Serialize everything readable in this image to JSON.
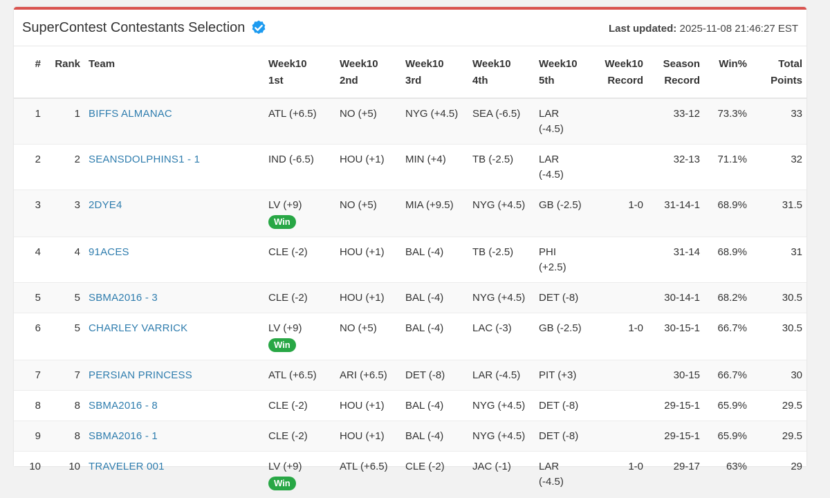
{
  "header": {
    "title": "SuperContest Contestants Selection",
    "last_updated_label": "Last updated:",
    "last_updated_value": "2025-11-08 21:46:27 EST"
  },
  "columns": {
    "num": "#",
    "rank": "Rank",
    "team": "Team",
    "w1": [
      "Week10",
      "1st"
    ],
    "w2": [
      "Week10",
      "2nd"
    ],
    "w3": [
      "Week10",
      "3rd"
    ],
    "w4": [
      "Week10",
      "4th"
    ],
    "w5": [
      "Week10",
      "5th"
    ],
    "record": [
      "Week10",
      "Record"
    ],
    "season": [
      "Season",
      "Record"
    ],
    "winpct": "Win%",
    "points": [
      "Total",
      "Points"
    ]
  },
  "win_label": "Win",
  "colors": {
    "accent": "#d9534f",
    "link": "#2f7dae",
    "win": "#28a745",
    "verified": "#1d9bf0"
  },
  "rows": [
    {
      "num": "1",
      "rank": "1",
      "team": "BIFFS ALMANAC",
      "picks": [
        "ATL (+6.5)",
        "NO (+5)",
        "NYG (+4.5)",
        "SEA (-6.5)",
        "LAR (-4.5)"
      ],
      "win_pick": null,
      "record": "",
      "season": "33-12",
      "winpct": "73.3%",
      "points": "33"
    },
    {
      "num": "2",
      "rank": "2",
      "team": "SEANSDOLPHINS1 - 1",
      "picks": [
        "IND (-6.5)",
        "HOU (+1)",
        "MIN (+4)",
        "TB (-2.5)",
        "LAR (-4.5)"
      ],
      "win_pick": null,
      "record": "",
      "season": "32-13",
      "winpct": "71.1%",
      "points": "32"
    },
    {
      "num": "3",
      "rank": "3",
      "team": "2DYE4",
      "picks": [
        "LV (+9)",
        "NO (+5)",
        "MIA (+9.5)",
        "NYG (+4.5)",
        "GB (-2.5)"
      ],
      "win_pick": 0,
      "record": "1-0",
      "season": "31-14-1",
      "winpct": "68.9%",
      "points": "31.5"
    },
    {
      "num": "4",
      "rank": "4",
      "team": "91ACES",
      "picks": [
        "CLE (-2)",
        "HOU (+1)",
        "BAL (-4)",
        "TB (-2.5)",
        "PHI (+2.5)"
      ],
      "win_pick": null,
      "record": "",
      "season": "31-14",
      "winpct": "68.9%",
      "points": "31"
    },
    {
      "num": "5",
      "rank": "5",
      "team": "SBMA2016 - 3",
      "picks": [
        "CLE (-2)",
        "HOU (+1)",
        "BAL (-4)",
        "NYG (+4.5)",
        "DET (-8)"
      ],
      "win_pick": null,
      "record": "",
      "season": "30-14-1",
      "winpct": "68.2%",
      "points": "30.5"
    },
    {
      "num": "6",
      "rank": "5",
      "team": "CHARLEY VARRICK",
      "picks": [
        "LV (+9)",
        "NO (+5)",
        "BAL (-4)",
        "LAC (-3)",
        "GB (-2.5)"
      ],
      "win_pick": 0,
      "record": "1-0",
      "season": "30-15-1",
      "winpct": "66.7%",
      "points": "30.5"
    },
    {
      "num": "7",
      "rank": "7",
      "team": "PERSIAN PRINCESS",
      "picks": [
        "ATL (+6.5)",
        "ARI (+6.5)",
        "DET (-8)",
        "LAR (-4.5)",
        "PIT (+3)"
      ],
      "win_pick": null,
      "record": "",
      "season": "30-15",
      "winpct": "66.7%",
      "points": "30"
    },
    {
      "num": "8",
      "rank": "8",
      "team": "SBMA2016 - 8",
      "picks": [
        "CLE (-2)",
        "HOU (+1)",
        "BAL (-4)",
        "NYG (+4.5)",
        "DET (-8)"
      ],
      "win_pick": null,
      "record": "",
      "season": "29-15-1",
      "winpct": "65.9%",
      "points": "29.5"
    },
    {
      "num": "9",
      "rank": "8",
      "team": "SBMA2016 - 1",
      "picks": [
        "CLE (-2)",
        "HOU (+1)",
        "BAL (-4)",
        "NYG (+4.5)",
        "DET (-8)"
      ],
      "win_pick": null,
      "record": "",
      "season": "29-15-1",
      "winpct": "65.9%",
      "points": "29.5"
    },
    {
      "num": "10",
      "rank": "10",
      "team": "TRAVELER 001",
      "picks": [
        "LV (+9)",
        "ATL (+6.5)",
        "CLE (-2)",
        "JAC (-1)",
        "LAR (-4.5)"
      ],
      "win_pick": 0,
      "record": "1-0",
      "season": "29-17",
      "winpct": "63%",
      "points": "29"
    }
  ]
}
